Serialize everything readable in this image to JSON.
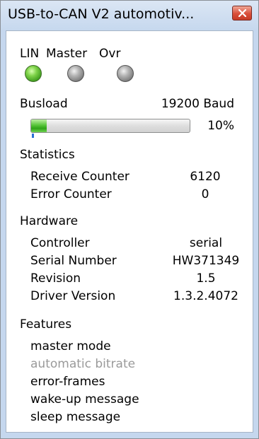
{
  "window": {
    "title": "USB-to-CAN V2 automotiv..."
  },
  "indicators": [
    {
      "label": "LIN",
      "state": "on",
      "color": "#4cc22b"
    },
    {
      "label": "Master",
      "state": "off",
      "color": "#9a9a9a"
    },
    {
      "label": "Ovr",
      "state": "off",
      "color": "#9a9a9a"
    }
  ],
  "busload": {
    "label": "Busload",
    "baud_text": "19200 Baud",
    "percent_text": "10%",
    "level_percent": 10
  },
  "statistics": {
    "heading": "Statistics",
    "rows": [
      {
        "label": "Receive Counter",
        "value": "6120"
      },
      {
        "label": "Error Counter",
        "value": "0"
      }
    ]
  },
  "hardware": {
    "heading": "Hardware",
    "rows": [
      {
        "label": "Controller",
        "value": "serial"
      },
      {
        "label": "Serial Number",
        "value": "HW371349"
      },
      {
        "label": "Revision",
        "value": "1.5"
      },
      {
        "label": "Driver Version",
        "value": "1.3.2.4072"
      }
    ]
  },
  "features": {
    "heading": "Features",
    "items": [
      {
        "label": "master mode",
        "enabled": true
      },
      {
        "label": "automatic bitrate",
        "enabled": false
      },
      {
        "label": "error-frames",
        "enabled": true
      },
      {
        "label": "wake-up message",
        "enabled": true
      },
      {
        "label": "sleep message",
        "enabled": true
      }
    ]
  },
  "colors": {
    "close_button": "#d94e39",
    "progress_fill": "#3fb325",
    "disabled_text": "#9a9a9a"
  }
}
